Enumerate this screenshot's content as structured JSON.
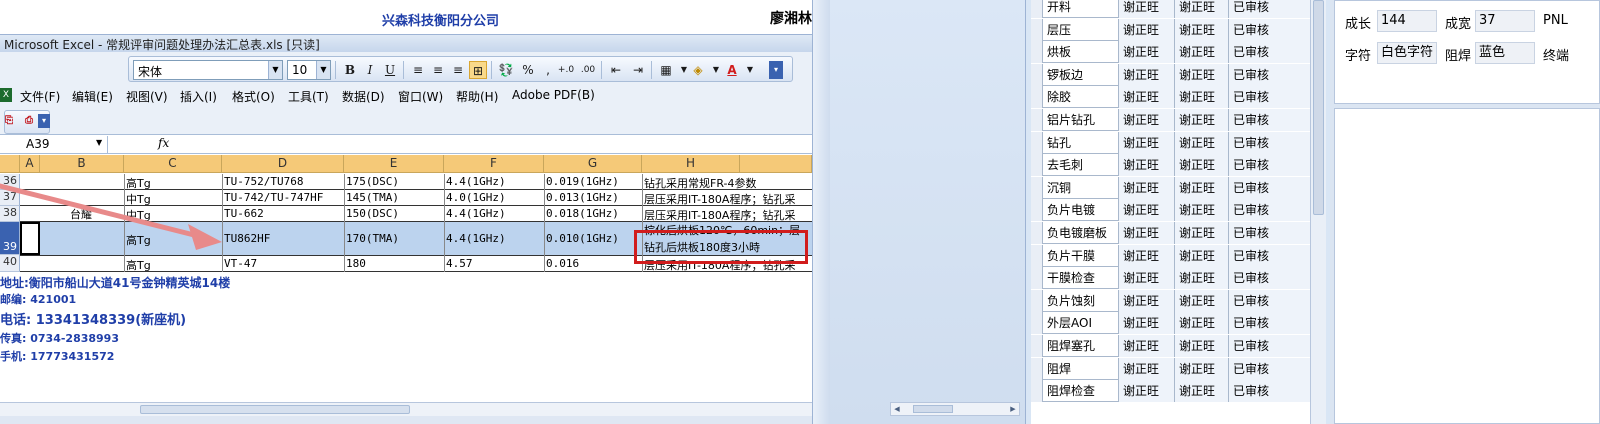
{
  "excel": {
    "company_name": "兴森科技衡阳分公司",
    "company_right": "廖湘林",
    "window_title": "Microsoft Excel - 常规评审问题处理办法汇总表.xls  [只读]",
    "font_name": "宋体",
    "font_size": "10",
    "toolbar": {
      "bold": "B",
      "italic": "I",
      "underline": "U",
      "percent": "%",
      "comma": ",",
      "inc_dec": "+.0",
      "dec_dec": ".00",
      "font_color_letter": "A"
    },
    "menu": [
      "文件(F)",
      "编辑(E)",
      "视图(V)",
      "插入(I)",
      "格式(O)",
      "工具(T)",
      "数据(D)",
      "窗口(W)",
      "帮助(H)",
      "Adobe PDF(B)"
    ],
    "name_box": "A39",
    "fx": "fx",
    "columns": [
      "A",
      "B",
      "C",
      "D",
      "E",
      "F",
      "G",
      "H"
    ],
    "row_numbers": [
      "36",
      "37",
      "38",
      "39",
      "40"
    ],
    "b_label": "台耀",
    "rows": [
      {
        "c": "高Tg",
        "d": "TU-752/TU768",
        "e": "175(DSC)",
        "f": "4.4(1GHz)",
        "g": "0.019(1GHz)",
        "h": "钻孔采用常规FR-4参数"
      },
      {
        "c": "中Tg",
        "d": "TU-742/TU-747HF",
        "e": "145(TMA)",
        "f": "4.0(1GHz)",
        "g": "0.013(1GHz)",
        "h": "层压采用IT-180A程序；钻孔采"
      },
      {
        "c": "中Tg",
        "d": "TU-662",
        "e": "150(DSC)",
        "f": "4.4(1GHz)",
        "g": "0.018(1GHz)",
        "h": "层压采用IT-180A程序；钻孔采"
      },
      {
        "c": "高Tg",
        "d": "TU862HF",
        "e": "170(TMA)",
        "f": "4.4(1GHz)",
        "g": "0.010(1GHz)",
        "h_top": "棕化后烘板120℃，60min；层",
        "h": "钻孔后烘板180度3小時"
      },
      {
        "c": "高Tg",
        "d": "VT-47",
        "e": "180",
        "f": "4.57",
        "g": "0.016",
        "h": "层压采用IT-180A程序；钻孔采"
      }
    ],
    "contact": {
      "address": "地址:衡阳市船山大道41号金钟精英城14楼",
      "postcode": "邮编: 421001",
      "phone": "电话: 13341348339(新座机)",
      "fax": "传真: 0734-2838993",
      "mobile": "手机: 17773431572"
    }
  },
  "process_list": {
    "rows": [
      {
        "step": "开料",
        "a": "谢正旺",
        "b": "谢正旺",
        "status": "已审核"
      },
      {
        "step": "层压",
        "a": "谢正旺",
        "b": "谢正旺",
        "status": "已审核"
      },
      {
        "step": "烘板",
        "a": "谢正旺",
        "b": "谢正旺",
        "status": "已审核"
      },
      {
        "step": "锣板边",
        "a": "谢正旺",
        "b": "谢正旺",
        "status": "已审核"
      },
      {
        "step": "除胶",
        "a": "谢正旺",
        "b": "谢正旺",
        "status": "已审核"
      },
      {
        "step": "铝片钻孔",
        "a": "谢正旺",
        "b": "谢正旺",
        "status": "已审核"
      },
      {
        "step": "钻孔",
        "a": "谢正旺",
        "b": "谢正旺",
        "status": "已审核"
      },
      {
        "step": "去毛刺",
        "a": "谢正旺",
        "b": "谢正旺",
        "status": "已审核"
      },
      {
        "step": "沉铜",
        "a": "谢正旺",
        "b": "谢正旺",
        "status": "已审核"
      },
      {
        "step": "负片电镀",
        "a": "谢正旺",
        "b": "谢正旺",
        "status": "已审核"
      },
      {
        "step": "负电镀磨板",
        "a": "谢正旺",
        "b": "谢正旺",
        "status": "已审核"
      },
      {
        "step": "负片干膜",
        "a": "谢正旺",
        "b": "谢正旺",
        "status": "已审核"
      },
      {
        "step": "干膜检查",
        "a": "谢正旺",
        "b": "谢正旺",
        "status": "已审核"
      },
      {
        "step": "负片蚀刻",
        "a": "谢正旺",
        "b": "谢正旺",
        "status": "已审核"
      },
      {
        "step": "外层AOI",
        "a": "谢正旺",
        "b": "谢正旺",
        "status": "已审核"
      },
      {
        "step": "阻焊塞孔",
        "a": "谢正旺",
        "b": "谢正旺",
        "status": "已审核"
      },
      {
        "step": "阻焊",
        "a": "谢正旺",
        "b": "谢正旺",
        "status": "已审核"
      },
      {
        "step": "阻焊检查",
        "a": "谢正旺",
        "b": "谢正旺",
        "status": "已审核"
      }
    ]
  },
  "detail": {
    "length_label": "成长",
    "length_value": "144",
    "width_label": "成宽",
    "width_value": "37",
    "pnl_label": "PNL",
    "char_label": "字符",
    "char_value": "白色字符",
    "mask_label": "阻焊",
    "mask_value": "蓝色",
    "end_label": "终端"
  },
  "colors": {
    "accent_blue": "#1f3ea8",
    "highlight_red": "#d11c1c",
    "header_orange": "#f5c978",
    "selected_row": "#bcd3ee"
  }
}
